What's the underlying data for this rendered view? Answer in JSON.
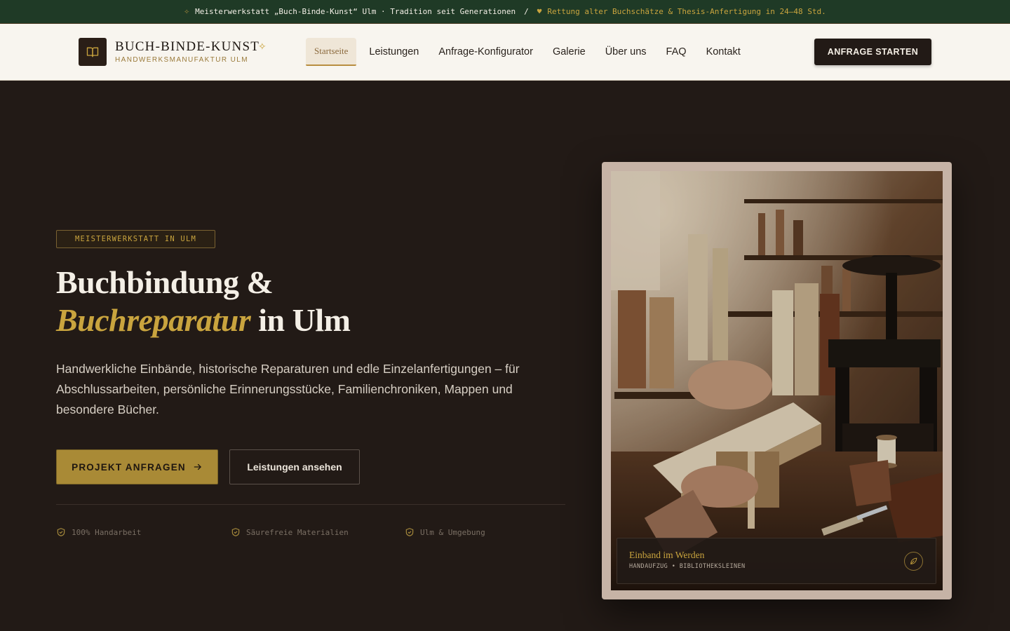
{
  "announcement": {
    "text_main": "Meisterwerkstatt „Buch-Binde-Kunst“ Ulm · Tradition seit Generationen",
    "separator": "/",
    "text_highlight": "Rettung alter Buchschätze & Thesis-Anfertigung in 24–48 Std."
  },
  "brand": {
    "name": "BUCH-BINDE-KUNST",
    "subtitle": "HANDWERKSMANUFAKTUR ULM"
  },
  "nav": {
    "items": [
      {
        "label": "Startseite",
        "active": true
      },
      {
        "label": "Leistungen"
      },
      {
        "label": "Anfrage-Konfigurator"
      },
      {
        "label": "Galerie"
      },
      {
        "label": "Über uns"
      },
      {
        "label": "FAQ"
      },
      {
        "label": "Kontakt"
      }
    ],
    "cta_label": "ANFRAGE STARTEN"
  },
  "hero": {
    "badge": "MEISTERWERKSTATT IN ULM",
    "title_line1": "Buchbindung &",
    "title_highlight": "Buchreparatur",
    "title_rest": " in Ulm",
    "lead": "Handwerkliche Einbände, historische Reparaturen und edle Einzelanfertigungen – für Abschlussarbeiten, persönliche Erinnerungsstücke, Familienchroniken, Mappen und besondere Bücher.",
    "primary_button": "PROJEKT ANFRAGEN",
    "secondary_button": "Leistungen ansehen",
    "features": [
      "100% Handarbeit",
      "Säurefreie Materialien",
      "Ulm & Umgebung"
    ]
  },
  "image_card": {
    "caption_title": "Einband im Werden",
    "caption_subtitle": "HANDAUFZUG • BIBLIOTHEKSLEINEN"
  },
  "colors": {
    "background": "#221a16",
    "topbar": "#1f3a26",
    "gold": "#c9a43e",
    "header_bg": "#f8f5ef"
  },
  "icons": [
    "sparkle-icon",
    "heart-icon",
    "book-icon",
    "arrow-right-icon",
    "shield-check-icon",
    "leaf-icon"
  ]
}
